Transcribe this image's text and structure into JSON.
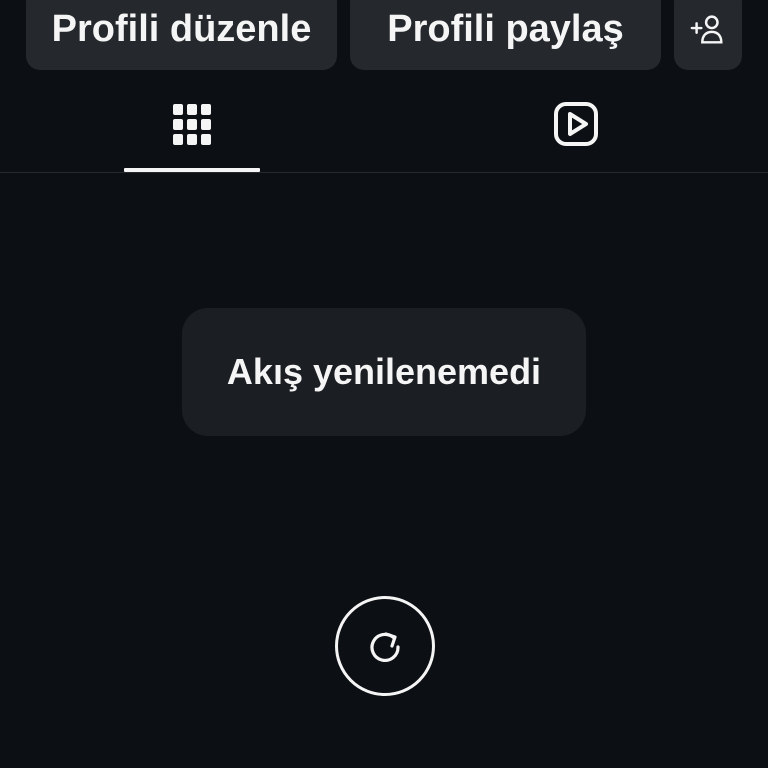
{
  "actions": {
    "edit_profile_label": "Profili düzenle",
    "share_profile_label": "Profili paylaş",
    "add_person_icon": "add-person-icon"
  },
  "tabs": [
    {
      "icon": "grid-icon",
      "selected": true
    },
    {
      "icon": "reels-icon",
      "selected": false
    }
  ],
  "feed": {
    "error_message": "Akış yenilenemedi",
    "retry_icon": "refresh-icon"
  },
  "colors": {
    "background": "#0c0f14",
    "button_bg": "#25292e",
    "toast_bg": "#1b1e23",
    "foreground": "#f5f5f5"
  }
}
